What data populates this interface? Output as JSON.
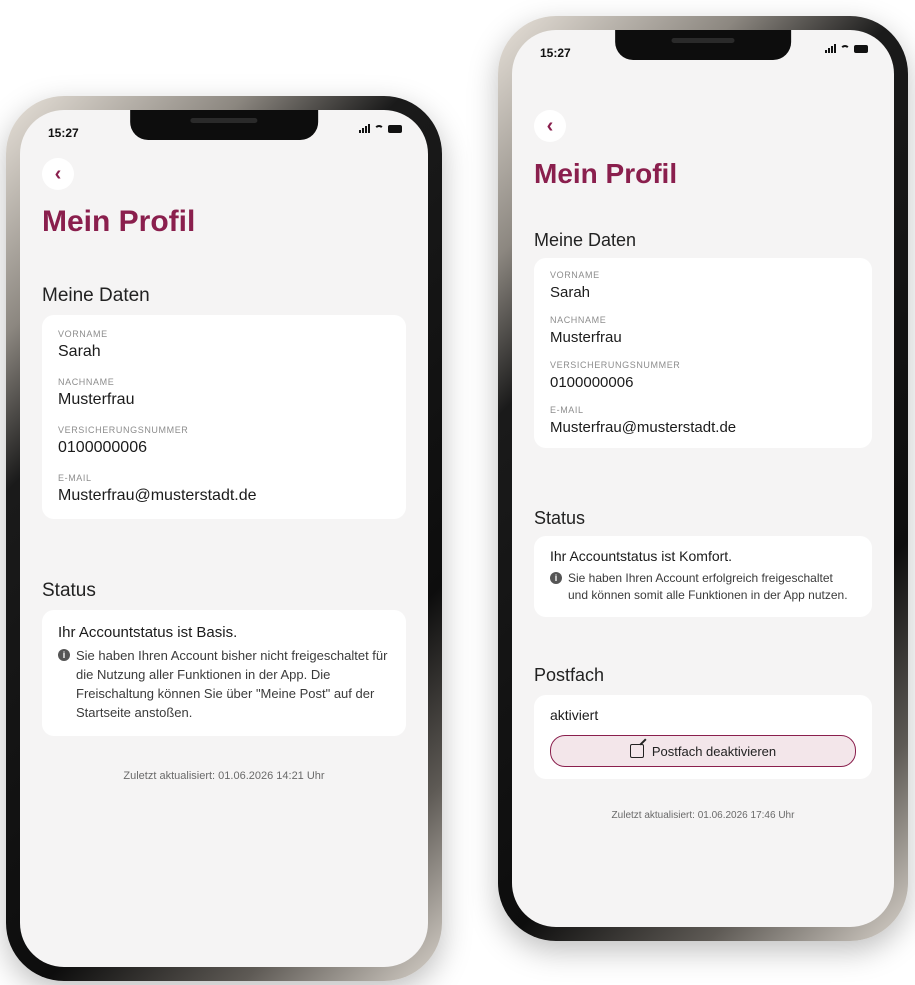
{
  "colors": {
    "accent": "#8a1f4d",
    "screen_bg": "#f5f4f4",
    "card_bg": "#ffffff"
  },
  "left_phone": {
    "status_bar": {
      "time": "15:27"
    },
    "back_icon": "chevron-left-icon",
    "title": "Mein Profil",
    "data_heading": "Meine Daten",
    "fields": [
      {
        "label": "VORNAME",
        "value": "Sarah"
      },
      {
        "label": "NACHNAME",
        "value": "Musterfrau"
      },
      {
        "label": "VERSICHERUNGSNUMMER",
        "value": "0100000006"
      },
      {
        "label": "E-MAIL",
        "value": "Musterfrau@musterstadt.de"
      }
    ],
    "status_heading": "Status",
    "status_text": "Ihr Accountstatus ist Basis.",
    "status_info": "Sie haben Ihren Account bisher nicht freige­schaltet für die Nutzung aller Funktionen in der App. Die Freischaltung können Sie über \"Meine Post\" auf der Startseite anstoßen.",
    "last_updated": "Zuletzt aktualisiert: 01.06.2026 14:21 Uhr"
  },
  "right_phone": {
    "status_bar": {
      "time": "15:27"
    },
    "back_icon": "chevron-left-icon",
    "title": "Mein Profil",
    "data_heading": "Meine Daten",
    "fields": [
      {
        "label": "VORNAME",
        "value": "Sarah"
      },
      {
        "label": "NACHNAME",
        "value": "Musterfrau"
      },
      {
        "label": "VERSICHERUNGSNUMMER",
        "value": "0100000006"
      },
      {
        "label": "E-MAIL",
        "value": "Musterfrau@musterstadt.de"
      }
    ],
    "status_heading": "Status",
    "status_text": "Ihr Accountstatus ist Komfort.",
    "status_info": "Sie haben Ihren Account erfolgreich freige­schaltet und können somit alle Funktionen in der App nutzen.",
    "postfach_heading": "Postfach",
    "postfach_status": "aktiviert",
    "postfach_button": "Postfach deaktivieren",
    "last_updated": "Zuletzt aktualisiert: 01.06.2026 17:46 Uhr"
  }
}
